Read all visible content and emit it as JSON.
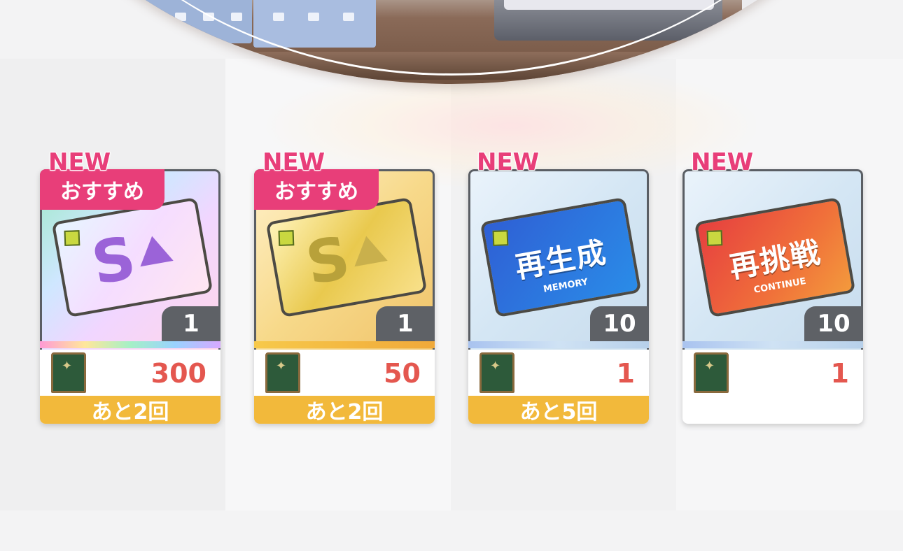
{
  "colors": {
    "new": "#e83e79",
    "recommend_bg": "#e83e79",
    "price": "#e4574f",
    "remain_bg": "#f2b93b",
    "badge_bg": "#5e6166"
  },
  "items": [
    {
      "new_label": "NEW",
      "recommend": "おすすめ",
      "ticket_icon": "rainbow-s-rank-up-ticket-icon",
      "ticket_letter": "S",
      "quantity": "1",
      "cost_icon": "medal-icon",
      "price": "300",
      "remaining": "あと2回"
    },
    {
      "new_label": "NEW",
      "recommend": "おすすめ",
      "ticket_icon": "gold-s-rank-up-ticket-icon",
      "ticket_letter": "S",
      "quantity": "1",
      "cost_icon": "medal-icon",
      "price": "50",
      "remaining": "あと2回"
    },
    {
      "new_label": "NEW",
      "ticket_icon": "memory-replay-ticket-icon",
      "ticket_text": "再生成",
      "ticket_sub": "MEMORY",
      "quantity": "10",
      "cost_icon": "medal-icon",
      "price": "1",
      "remaining": "あと5回"
    },
    {
      "new_label": "NEW",
      "ticket_icon": "continue-retry-ticket-icon",
      "ticket_text": "再挑戦",
      "ticket_sub": "CONTINUE",
      "quantity": "10",
      "cost_icon": "medal-icon",
      "price": "1"
    }
  ]
}
